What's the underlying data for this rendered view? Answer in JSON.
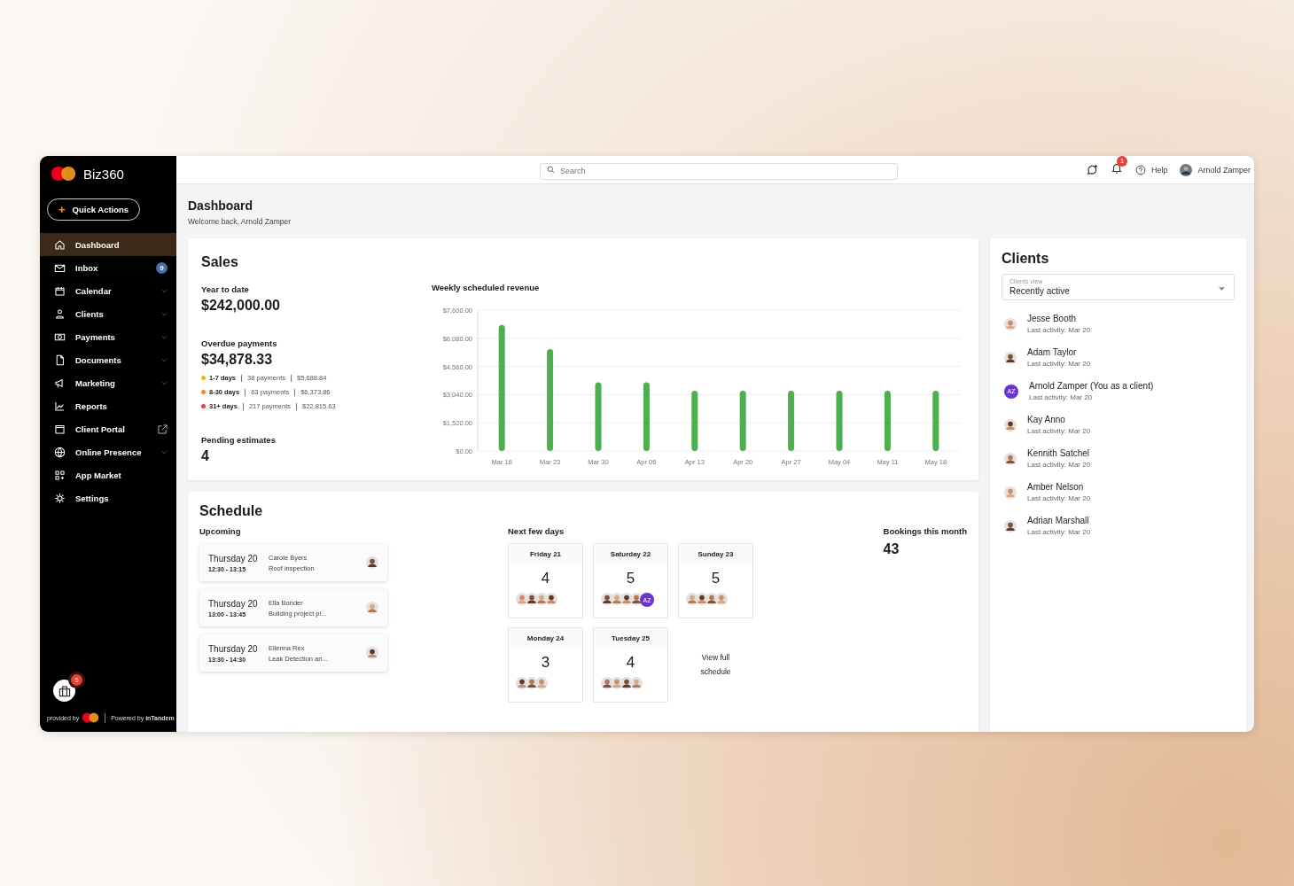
{
  "sidebar": {
    "brand": "Biz360",
    "quick_action": {
      "icon": "+",
      "label": "Quick Actions"
    },
    "items": [
      {
        "label": "Dashboard",
        "selected": true,
        "kind": "plain"
      },
      {
        "label": "Inbox",
        "selected": false,
        "kind": "plain",
        "badge": "9"
      },
      {
        "label": "Calendar",
        "selected": false,
        "kind": "group"
      },
      {
        "label": "Clients",
        "selected": false,
        "kind": "group"
      },
      {
        "label": "Payments",
        "selected": false,
        "kind": "group"
      },
      {
        "label": "Documents",
        "selected": false,
        "kind": "group"
      },
      {
        "label": "Marketing",
        "selected": false,
        "kind": "group"
      },
      {
        "label": "Reports",
        "selected": false,
        "kind": "plain"
      },
      {
        "label": "Client Portal",
        "selected": false,
        "kind": "external"
      },
      {
        "label": "Online Presence",
        "selected": false,
        "kind": "group"
      },
      {
        "label": "App Market",
        "selected": false,
        "kind": "plain"
      },
      {
        "label": "Settings",
        "selected": false,
        "kind": "plain"
      }
    ],
    "bag_badge": "5",
    "footer": {
      "provided": "provided by",
      "powered": "Powered by **inTandem**"
    }
  },
  "topbar": {
    "search": {
      "placeholder": "Search"
    },
    "notifications": "1",
    "help": "Help",
    "user": "Arnold Zamper"
  },
  "header": {
    "title": "Dashboard",
    "subtitle": "Welcome back, Arnold Zamper"
  },
  "sales": {
    "title": "Sales",
    "ytd_label": "Year to date",
    "ytd_value": "$242,000.00",
    "overdue_label": "Overdue payments",
    "overdue_value": "$34,878.33",
    "overdue_rows": [
      {
        "range": "1-7 days",
        "payments": "38 payments",
        "amount": "$5,688.84",
        "color": "#f7b500"
      },
      {
        "range": "8-30 days",
        "payments": "63 payments",
        "amount": "$6,373.86",
        "color": "#f58a1f"
      },
      {
        "range": "31+ days",
        "payments": "217 payments",
        "amount": "$22,815.63",
        "color": "#e8413c"
      }
    ],
    "pending_label": "Pending estimates",
    "pending_value": "4",
    "chart_data": {
      "type": "bar",
      "title": "Weekly scheduled revenue",
      "categories": [
        "Mar 16",
        "Mar 23",
        "Mar 30",
        "Apr 06",
        "Apr 13",
        "Apr 20",
        "Apr 27",
        "May 04",
        "May 11",
        "May 18"
      ],
      "grid": true,
      "series": [
        {
          "color": "#4caf50",
          "values": [
            6800,
            5500,
            3700,
            3700,
            3250,
            3250,
            3250,
            3250,
            3250,
            3250
          ]
        }
      ],
      "ylim": [
        0,
        7600
      ],
      "yticks": [
        {
          "value": 0,
          "label": "$0.00"
        },
        {
          "value": 1520,
          "label": "$1,520.00"
        },
        {
          "value": 3040,
          "label": "$3,040.00"
        },
        {
          "value": 4560,
          "label": "$4,560.00"
        },
        {
          "value": 6080,
          "label": "$6,080.00"
        },
        {
          "value": 7600,
          "label": "$7,600.00"
        }
      ]
    }
  },
  "schedule": {
    "title": "Schedule",
    "upcoming_label": "Upcoming",
    "upcoming": [
      {
        "day": "Thursday 20",
        "time": "12:30 - 13:15",
        "client": "Carole Byers",
        "job": "Roof inspection"
      },
      {
        "day": "Thursday 20",
        "time": "13:00 - 13:45",
        "client": "Ella Bonder",
        "job": "Building project pl..."
      },
      {
        "day": "Thursday 20",
        "time": "13:30 - 14:30",
        "client": "Ellenna Rex",
        "job": "Leak Detection an..."
      }
    ],
    "next_label": "Next few days",
    "days": [
      {
        "label": "Friday 21",
        "count": "4",
        "avatars": [
          {
            "kind": "photo"
          },
          {
            "kind": "photo"
          },
          {
            "kind": "photo"
          },
          {
            "kind": "photo"
          }
        ]
      },
      {
        "label": "Saturday 22",
        "count": "5",
        "avatars": [
          {
            "kind": "photo"
          },
          {
            "kind": "photo"
          },
          {
            "kind": "photo"
          },
          {
            "kind": "photo"
          },
          {
            "kind": "initials",
            "text": "AZ"
          }
        ]
      },
      {
        "label": "Sunday 23",
        "count": "5",
        "avatars": [
          {
            "kind": "photo"
          },
          {
            "kind": "photo"
          },
          {
            "kind": "photo"
          },
          {
            "kind": "photo"
          }
        ]
      },
      {
        "label": "Monday 24",
        "count": "3",
        "avatars": [
          {
            "kind": "photo"
          },
          {
            "kind": "photo"
          },
          {
            "kind": "photo"
          }
        ]
      },
      {
        "label": "Tuesday 25",
        "count": "4",
        "avatars": [
          {
            "kind": "photo"
          },
          {
            "kind": "photo"
          },
          {
            "kind": "photo"
          },
          {
            "kind": "photo"
          }
        ]
      }
    ],
    "view_full": "View full schedule",
    "bookings_label": "Bookings this month",
    "bookings_value": "43"
  },
  "clients": {
    "title": "Clients",
    "view_label": "Clients view",
    "view_value": "Recently active",
    "items": [
      {
        "name": "Jesse Booth",
        "activity": "Last activity: Mar 20",
        "avatar": {
          "kind": "photo"
        }
      },
      {
        "name": "Adam Taylor",
        "activity": "Last activity: Mar 20",
        "avatar": {
          "kind": "photo"
        }
      },
      {
        "name": "Arnold Zamper (You as a client)",
        "activity": "Last activity: Mar 20",
        "avatar": {
          "kind": "initials",
          "text": "AZ"
        }
      },
      {
        "name": "Kay Anno",
        "activity": "Last activity: Mar 20",
        "avatar": {
          "kind": "photo"
        }
      },
      {
        "name": "Kennith Satchel",
        "activity": "Last activity: Mar 20",
        "avatar": {
          "kind": "photo"
        }
      },
      {
        "name": "Amber Nelson",
        "activity": "Last activity: Mar 20",
        "avatar": {
          "kind": "photo"
        }
      },
      {
        "name": "Adrian Marshall",
        "activity": "Last activity: Mar 20",
        "avatar": {
          "kind": "photo"
        }
      }
    ]
  }
}
